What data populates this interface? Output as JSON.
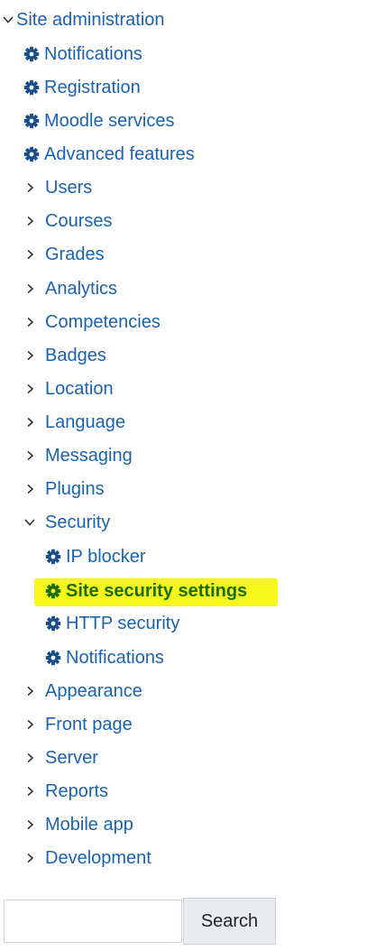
{
  "tree": {
    "root": "Site administration",
    "top_items": [
      "Notifications",
      "Registration",
      "Moodle services",
      "Advanced features"
    ],
    "categories_before": [
      "Users",
      "Courses",
      "Grades",
      "Analytics",
      "Competencies",
      "Badges",
      "Location",
      "Language",
      "Messaging",
      "Plugins"
    ],
    "security": {
      "label": "Security",
      "children": [
        "IP blocker",
        "Site security settings",
        "HTTP security",
        "Notifications"
      ],
      "current_index": 1
    },
    "categories_after": [
      "Appearance",
      "Front page",
      "Server",
      "Reports",
      "Mobile app",
      "Development"
    ]
  },
  "search": {
    "value": "",
    "button_label": "Search"
  },
  "icons": {
    "expanded": "chevron-down-icon",
    "collapsed": "chevron-right-icon",
    "settings": "gear-icon"
  },
  "colors": {
    "link": "#1a62b0",
    "current_text": "#1d6e12",
    "highlight": "#f6f61a",
    "icon": "#1a4f8b"
  }
}
